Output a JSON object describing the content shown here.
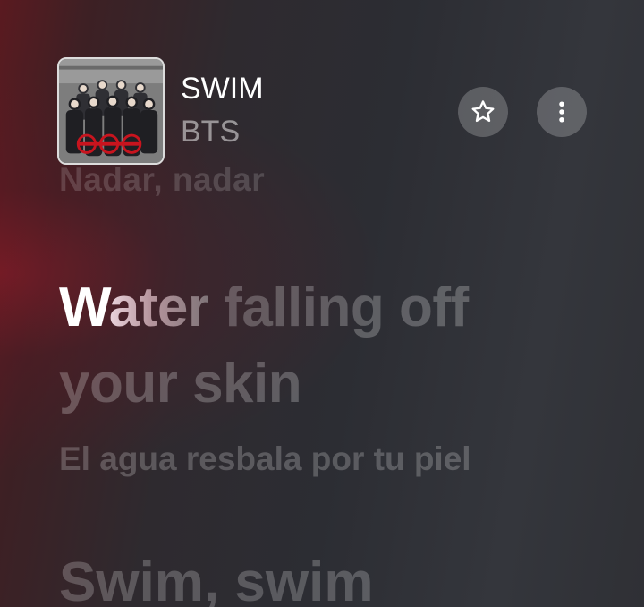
{
  "now_playing": {
    "title": "SWIM",
    "artist": "BTS",
    "artwork_icon": "album-artwork"
  },
  "actions": {
    "favorite_icon": "star-icon",
    "more_icon": "more-vertical-icon"
  },
  "lyrics": {
    "previous_line": "Nadar, nadar",
    "current_line": {
      "sung": "W",
      "fading": "ater",
      "rest": " falling off your skin"
    },
    "current_translation": "El agua resbala por tu piel",
    "next_line": "Swim, swim"
  },
  "colors": {
    "accent_red": "#8a1e2a",
    "text_active": "#ffffff"
  }
}
